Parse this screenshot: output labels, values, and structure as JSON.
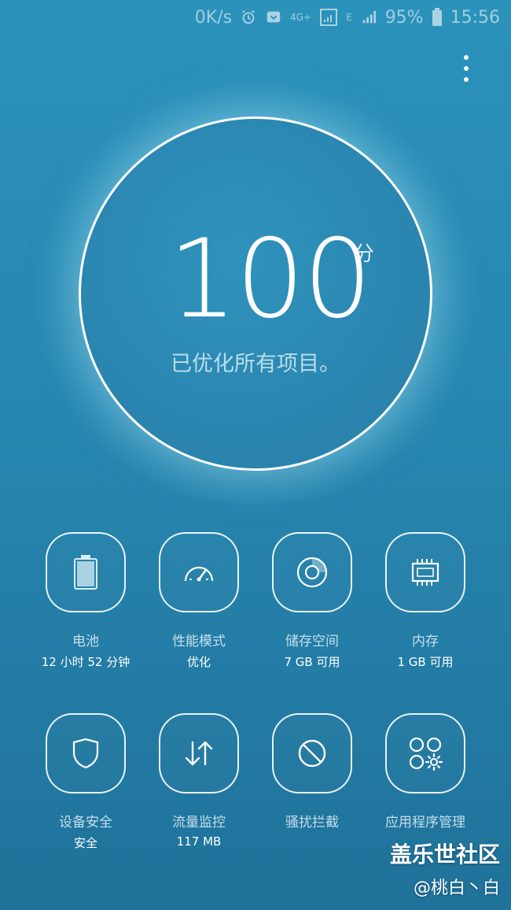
{
  "status_bar": {
    "speed": "0K/s",
    "alarm_icon": "alarm-icon",
    "message_icon": "message-icon",
    "network_4g": "4G+",
    "network_e": "E",
    "battery_pct": "95%",
    "time": "15:56"
  },
  "score": {
    "value": "100",
    "unit": "分",
    "message": "已优化所有项目。"
  },
  "tiles_row1": [
    {
      "label": "电池",
      "sub": "12 小时 52 分钟",
      "icon": "battery-icon"
    },
    {
      "label": "性能模式",
      "sub": "优化",
      "icon": "speedometer-icon"
    },
    {
      "label": "储存空间",
      "sub": "7 GB 可用",
      "icon": "storage-icon"
    },
    {
      "label": "内存",
      "sub": "1 GB 可用",
      "icon": "memory-chip-icon"
    }
  ],
  "tiles_row2": [
    {
      "label": "设备安全",
      "sub": "安全",
      "icon": "shield-icon"
    },
    {
      "label": "流量监控",
      "sub": "117 MB",
      "icon": "data-transfer-icon"
    },
    {
      "label": "骚扰拦截",
      "sub": "",
      "icon": "block-icon"
    },
    {
      "label": "应用程序管理",
      "sub": "",
      "icon": "app-manager-icon"
    }
  ],
  "watermark": {
    "title": "盖乐世社区",
    "user": "@桃白丶白"
  },
  "colors": {
    "bg_top": "#2b92bb",
    "bg_bottom": "#1f729a",
    "accent": "#ffffff"
  }
}
